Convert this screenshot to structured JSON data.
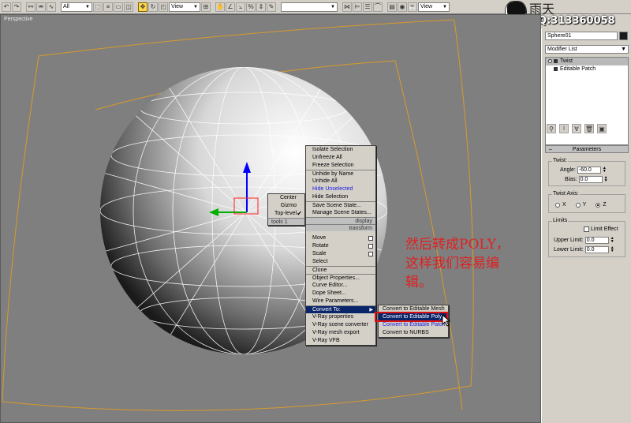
{
  "toolbar": {
    "filter": "All",
    "coord1": "View",
    "coord2": "View",
    "selset": ""
  },
  "watermark": {
    "name": "雨天",
    "qq": "QQ:313360058"
  },
  "viewport": {
    "label": "Perspective"
  },
  "panel": {
    "object_name": "Sphere01",
    "modifier_list": "Modifier List",
    "stack": [
      "Twist",
      "Editable Patch"
    ],
    "rollout_title": "Parameters",
    "twist_group": "Twist:",
    "angle_label": "Angle:",
    "angle_value": "-60.0",
    "bias_label": "Bias:",
    "bias_value": "0.0",
    "axis_group": "Twist Axis:",
    "axis_x": "X",
    "axis_y": "Y",
    "axis_z": "Z",
    "limits_group": "Limits",
    "limit_effect": "Limit Effect",
    "upper_label": "Upper Limit:",
    "upper_value": "0.0",
    "lower_label": "Lower Limit:",
    "lower_value": "0.0"
  },
  "quad_left": {
    "items": [
      "Center",
      "Gizmo",
      "Top-level"
    ],
    "footer": "tools 1"
  },
  "quad_right": {
    "items_top": [
      "Isolate Selection",
      "Unfreeze All",
      "Freeze Selection",
      "Unhide by Name",
      "Unhide All",
      "Hide Unselected",
      "Hide Selection",
      "Save Scene State...",
      "Manage Scene States..."
    ],
    "display_label": "display",
    "transform_label": "transform",
    "items_bottom": [
      "Move",
      "Rotate",
      "Scale",
      "Select",
      "Clone",
      "Object Properties...",
      "Curve Editor...",
      "Dope Sheet...",
      "Wire Parameters...",
      "Convert To:",
      "V-Ray properties",
      "V-Ray scene converter",
      "V-Ray mesh export",
      "V-Ray VFB"
    ]
  },
  "submenu": {
    "items": [
      "Convert to Editable Mesh",
      "Convert to Editable Poly",
      "Convert to Editable Patch",
      "Convert to NURBS"
    ]
  },
  "annotation": {
    "line1": "然后转成POLY，",
    "line2": "这样我们容易编",
    "line3": "辑。"
  },
  "colors": {
    "viewport_bg": "#7f7f7f",
    "highlight": "#0a246a",
    "annotation": "#e02020",
    "bbox": "#d89a2c"
  }
}
